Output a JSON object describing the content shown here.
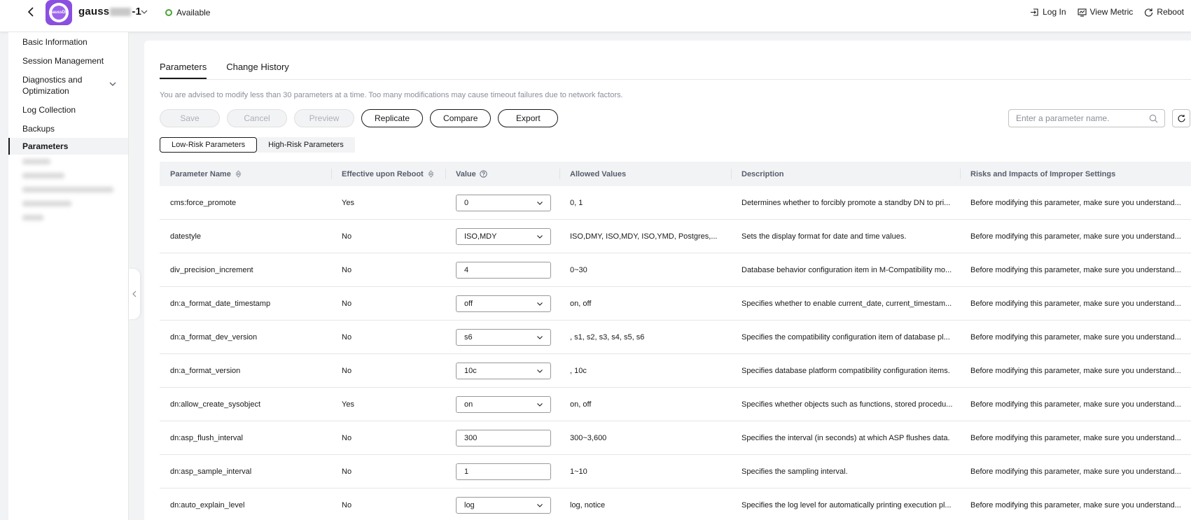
{
  "header": {
    "instance_name_prefix": "gauss",
    "instance_name_suffix": "-1",
    "status": "Available",
    "actions": [
      {
        "label": "Log In",
        "icon": "login-icon"
      },
      {
        "label": "View Metric",
        "icon": "metric-icon"
      },
      {
        "label": "Reboot",
        "icon": "reboot-icon"
      }
    ],
    "logo_text": "GaussDB",
    "brand_color": "#8a4fe0",
    "status_color": "#4ca338"
  },
  "sidebar": {
    "items": [
      {
        "label": "Basic Information"
      },
      {
        "label": "Session Management"
      },
      {
        "label": "Diagnostics and Optimization"
      },
      {
        "label": "Log Collection"
      },
      {
        "label": "Backups"
      },
      {
        "label": "Parameters"
      }
    ],
    "active": "Parameters"
  },
  "main": {
    "tabs": [
      {
        "label": "Parameters"
      },
      {
        "label": "Change History"
      }
    ],
    "tip": "You are advised to modify less than 30 parameters at a time. Too many modifications may cause timeout failures due to network factors.",
    "buttons": {
      "save": "Save",
      "cancel": "Cancel",
      "preview": "Preview",
      "replicate": "Replicate",
      "compare": "Compare",
      "export": "Export"
    },
    "search_placeholder": "Enter a parameter name.",
    "segments": [
      {
        "label": "Low-Risk Parameters"
      },
      {
        "label": "High-Risk Parameters"
      }
    ]
  },
  "table": {
    "headers": {
      "name": "Parameter Name",
      "reboot": "Effective upon Reboot",
      "value": "Value",
      "allowed": "Allowed Values",
      "description": "Description",
      "risks": "Risks and Impacts of Improper Settings"
    },
    "rows": [
      {
        "name": "cms:force_promote",
        "reboot": "Yes",
        "value": "0",
        "allowed": "0, 1",
        "description": "Determines whether to forcibly promote a standby DN to pri...",
        "risks": "Before modifying this parameter, make sure you understand..."
      },
      {
        "name": "datestyle",
        "reboot": "No",
        "value": "ISO,MDY",
        "allowed": "ISO,DMY, ISO,MDY, ISO,YMD, Postgres,...",
        "description": "Sets the display format for date and time values.",
        "risks": "Before modifying this parameter, make sure you understand..."
      },
      {
        "name": "div_precision_increment",
        "reboot": "No",
        "value": "4",
        "allowed": "0~30",
        "description": "Database behavior configuration item in M-Compatibility mo...",
        "risks": "Before modifying this parameter, make sure you understand..."
      },
      {
        "name": "dn:a_format_date_timestamp",
        "reboot": "No",
        "value": "off",
        "allowed": "on, off",
        "description": "Specifies whether to enable current_date, current_timestam...",
        "risks": "Before modifying this parameter, make sure you understand..."
      },
      {
        "name": "dn:a_format_dev_version",
        "reboot": "No",
        "value": "s6",
        "allowed": ", s1, s2, s3, s4, s5, s6",
        "description": "Specifies the compatibility configuration item of database pl...",
        "risks": "Before modifying this parameter, make sure you understand..."
      },
      {
        "name": "dn:a_format_version",
        "reboot": "No",
        "value": "10c",
        "allowed": ", 10c",
        "description": "Specifies database platform compatibility configuration items.",
        "risks": "Before modifying this parameter, make sure you understand..."
      },
      {
        "name": "dn:allow_create_sysobject",
        "reboot": "Yes",
        "value": "on",
        "allowed": "on, off",
        "description": "Specifies whether objects such as functions, stored procedu...",
        "risks": "Before modifying this parameter, make sure you understand..."
      },
      {
        "name": "dn:asp_flush_interval",
        "reboot": "No",
        "value": "300",
        "allowed": "300~3,600",
        "description": "Specifies the interval (in seconds) at which ASP flushes data.",
        "risks": "Before modifying this parameter, make sure you understand..."
      },
      {
        "name": "dn:asp_sample_interval",
        "reboot": "No",
        "value": "1",
        "allowed": "1~10",
        "description": "Specifies the sampling interval.",
        "risks": "Before modifying this parameter, make sure you understand..."
      },
      {
        "name": "dn:auto_explain_level",
        "reboot": "No",
        "value": "log",
        "allowed": "log, notice",
        "description": "Specifies the log level for automatically printing execution pl...",
        "risks": "Before modifying this parameter, make sure you understand..."
      }
    ]
  }
}
